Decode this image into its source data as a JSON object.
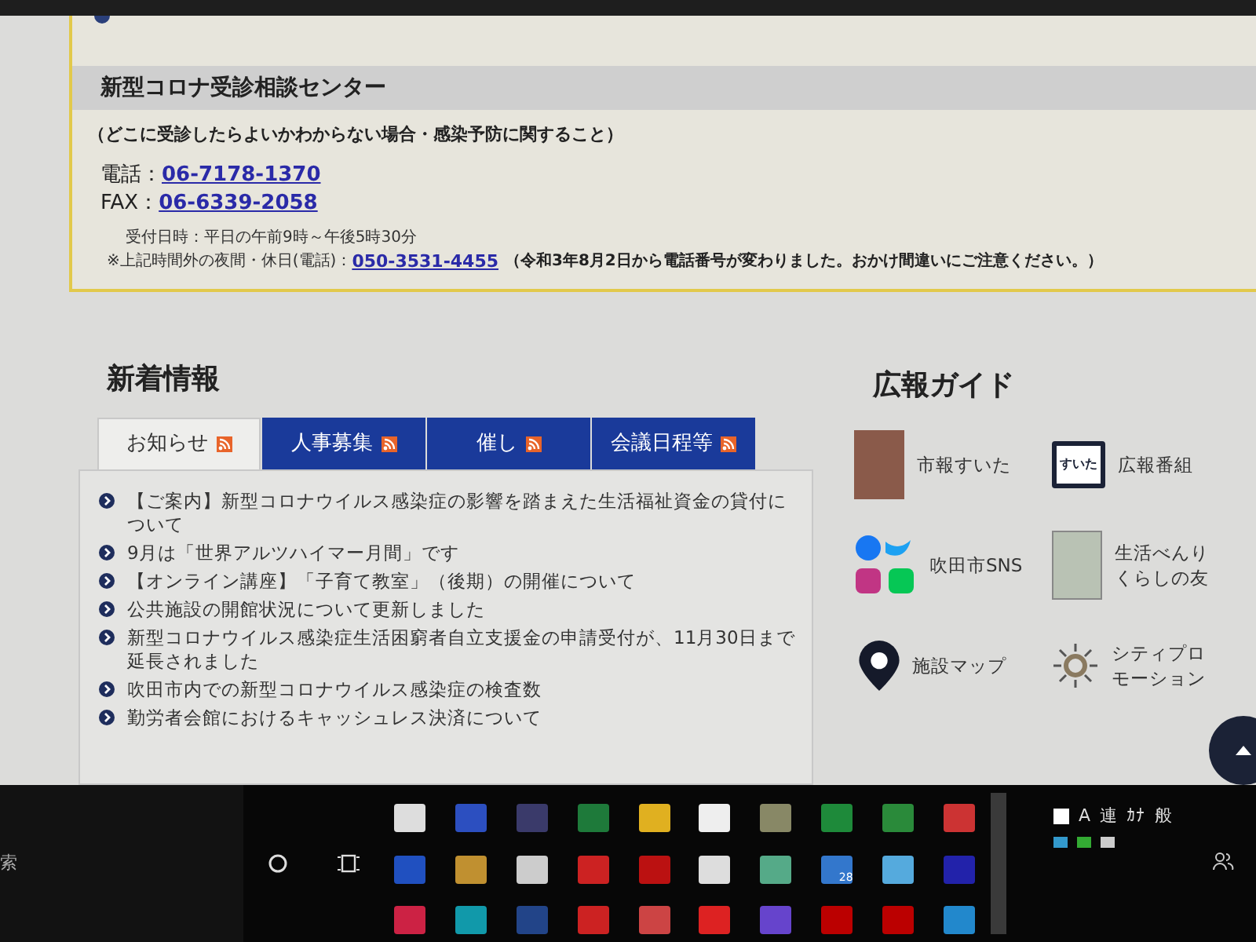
{
  "consult": {
    "title": "新型コロナ受診相談センター",
    "note": "（どこに受診したらよいかわからない場合・感染予防に関すること）",
    "contacts": [
      {
        "label": "電話：",
        "number": "06-7178-1370"
      },
      {
        "label": "FAX：",
        "number": "06-6339-2058"
      }
    ],
    "hours": "受付日時：平日の午前9時～午後5時30分",
    "after_label": "※上記時間外の夜間・休日(電話)：",
    "after_number": "050-3531-4455",
    "after_note": "（令和3年8月2日から電話番号が変わりました。おかけ間違いにご注意ください。）"
  },
  "news": {
    "title": "新着情報",
    "tabs": [
      {
        "label": "お知らせ",
        "selected": true
      },
      {
        "label": "人事募集",
        "selected": false
      },
      {
        "label": "催し",
        "selected": false
      },
      {
        "label": "会議日程等",
        "selected": false
      }
    ],
    "items": [
      "【ご案内】新型コロナウイルス感染症の影響を踏まえた生活福祉資金の貸付について",
      "9月は「世界アルツハイマー月間」です",
      "【オンライン講座】「子育て教室」（後期）の開催について",
      "公共施設の開館状況について更新しました",
      "新型コロナウイルス感染症生活困窮者自立支援金の申請受付が、11月30日まで延長されました",
      "吹田市内での新型コロナウイルス感染症の検査数",
      "勤労者会館におけるキャッシュレス決済について"
    ]
  },
  "guide": {
    "title": "広報ガイド",
    "items": [
      {
        "kind": "photo",
        "label": "市報すいた"
      },
      {
        "kind": "tv",
        "label": "広報番組",
        "icon_text": "すいた"
      },
      {
        "kind": "sns",
        "label": "吹田市SNS"
      },
      {
        "kind": "booklet",
        "label": "生活べんりくらしの友"
      },
      {
        "kind": "pin",
        "label": "施設マップ"
      },
      {
        "kind": "logo",
        "label": "シティプロモーション"
      }
    ]
  },
  "taskbar": {
    "search_fragment": "索",
    "mail_badge": "28",
    "ime": [
      "A",
      "連",
      "ｶﾅ",
      "般"
    ]
  }
}
